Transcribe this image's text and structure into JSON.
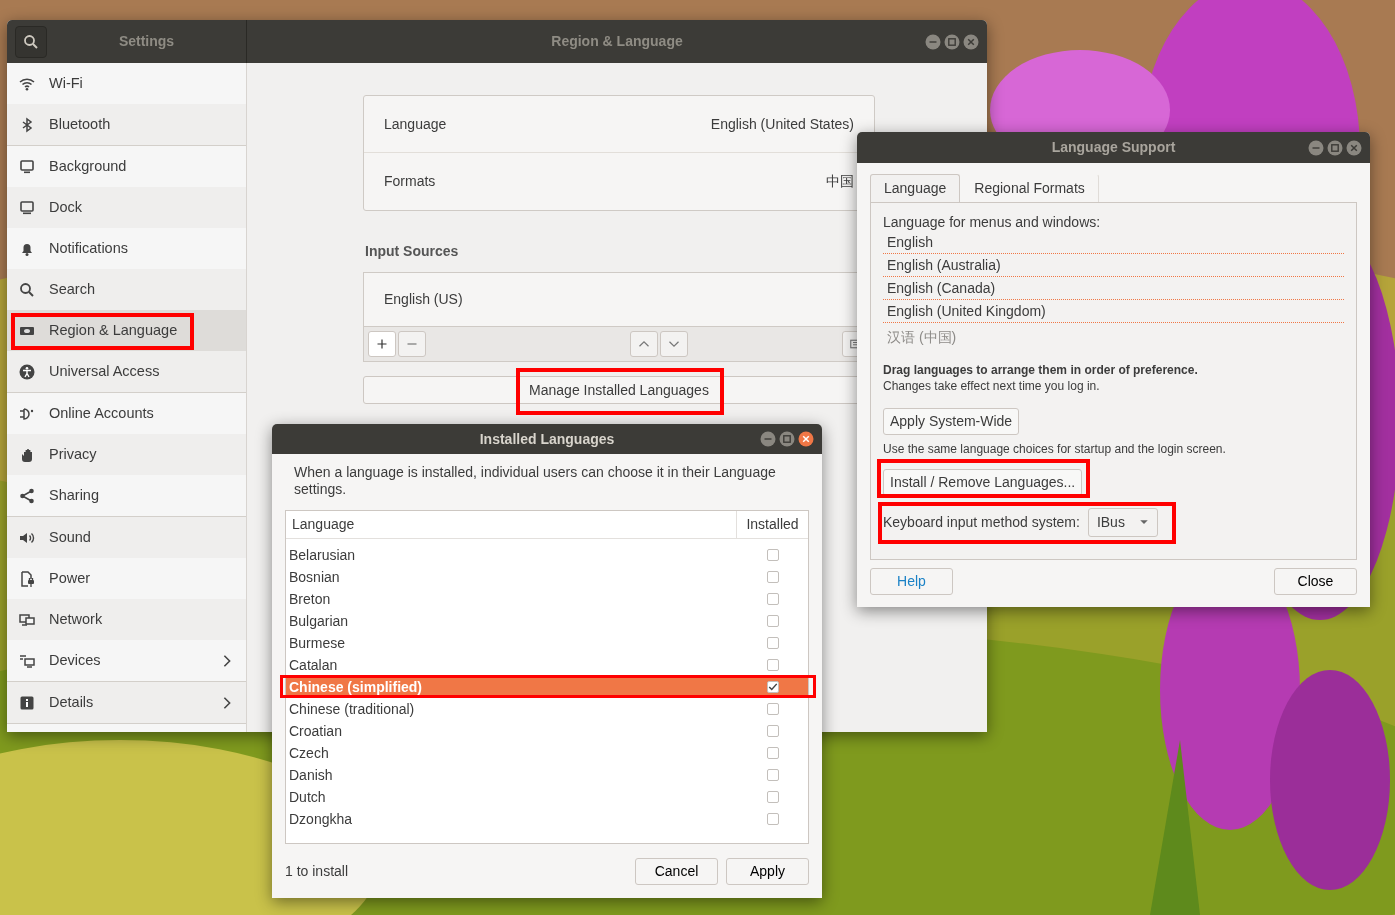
{
  "settings_window": {
    "sidebar_title": "Settings",
    "title": "Region & Language",
    "sidebar_groups": [
      [
        {
          "label": "Wi-Fi",
          "selected": false,
          "highlighted": false,
          "submenu": false
        },
        {
          "label": "Bluetooth",
          "selected": false,
          "highlighted": false,
          "submenu": false
        }
      ],
      [
        {
          "label": "Background",
          "selected": false,
          "highlighted": false,
          "submenu": false
        },
        {
          "label": "Dock",
          "selected": false,
          "highlighted": false,
          "submenu": false
        },
        {
          "label": "Notifications",
          "selected": false,
          "highlighted": false,
          "submenu": false
        },
        {
          "label": "Search",
          "selected": false,
          "highlighted": false,
          "submenu": false
        },
        {
          "label": "Region & Language",
          "selected": true,
          "highlighted": true,
          "submenu": false
        },
        {
          "label": "Universal Access",
          "selected": false,
          "highlighted": false,
          "submenu": false
        }
      ],
      [
        {
          "label": "Online Accounts",
          "selected": false,
          "highlighted": false,
          "submenu": false
        },
        {
          "label": "Privacy",
          "selected": false,
          "highlighted": false,
          "submenu": false
        },
        {
          "label": "Sharing",
          "selected": false,
          "highlighted": false,
          "submenu": false
        }
      ],
      [
        {
          "label": "Sound",
          "selected": false,
          "highlighted": false,
          "submenu": false
        },
        {
          "label": "Power",
          "selected": false,
          "highlighted": false,
          "submenu": false
        },
        {
          "label": "Network",
          "selected": false,
          "highlighted": false,
          "submenu": false
        },
        {
          "label": "Devices",
          "selected": false,
          "highlighted": false,
          "submenu": true
        }
      ],
      [
        {
          "label": "Details",
          "selected": false,
          "highlighted": false,
          "submenu": true
        }
      ]
    ],
    "language_rows": [
      {
        "label": "Language",
        "value": "English (United States)"
      },
      {
        "label": "Formats",
        "value": "中国"
      }
    ],
    "input_sources_heading": "Input Sources",
    "input_sources": [
      "English (US)"
    ],
    "manage_button": {
      "label": "Manage Installed Languages",
      "highlighted": true
    }
  },
  "language_support": {
    "title": "Language Support",
    "tabs": [
      {
        "label": "Language",
        "selected": true
      },
      {
        "label": "Regional Formats",
        "selected": false
      }
    ],
    "list_label": "Language for menus and windows:",
    "languages": [
      {
        "label": "English",
        "dimmed": false
      },
      {
        "label": "English (Australia)",
        "dimmed": false
      },
      {
        "label": "English (Canada)",
        "dimmed": false
      },
      {
        "label": "English (United Kingdom)",
        "dimmed": false
      },
      {
        "label": "汉语 (中国)",
        "dimmed": true
      }
    ],
    "drag_hint": "Drag languages to arrange them in order of preference.",
    "drag_note": "Changes take effect next time you log in.",
    "apply_button": "Apply System-Wide",
    "apply_note": "Use the same language choices for startup and the login screen.",
    "install_button": {
      "label": "Install / Remove Languages...",
      "highlighted": true
    },
    "keyboard": {
      "label": "Keyboard input method system:",
      "value": "IBus",
      "highlighted": true
    },
    "help_button": "Help",
    "close_button": "Close"
  },
  "installed_languages": {
    "title": "Installed Languages",
    "intro": "When a language is installed, individual users can choose it in their Language settings.",
    "columns": [
      "Language",
      "Installed"
    ],
    "rows": [
      {
        "name": "Belarusian",
        "installed": false,
        "selected": false,
        "highlighted": false
      },
      {
        "name": "Bosnian",
        "installed": false,
        "selected": false,
        "highlighted": false
      },
      {
        "name": "Breton",
        "installed": false,
        "selected": false,
        "highlighted": false
      },
      {
        "name": "Bulgarian",
        "installed": false,
        "selected": false,
        "highlighted": false
      },
      {
        "name": "Burmese",
        "installed": false,
        "selected": false,
        "highlighted": false
      },
      {
        "name": "Catalan",
        "installed": false,
        "selected": false,
        "highlighted": false
      },
      {
        "name": "Chinese (simplified)",
        "installed": true,
        "selected": true,
        "highlighted": true
      },
      {
        "name": "Chinese (traditional)",
        "installed": false,
        "selected": false,
        "highlighted": false
      },
      {
        "name": "Croatian",
        "installed": false,
        "selected": false,
        "highlighted": false
      },
      {
        "name": "Czech",
        "installed": false,
        "selected": false,
        "highlighted": false
      },
      {
        "name": "Danish",
        "installed": false,
        "selected": false,
        "highlighted": false
      },
      {
        "name": "Dutch",
        "installed": false,
        "selected": false,
        "highlighted": false
      },
      {
        "name": "Dzongkha",
        "installed": false,
        "selected": false,
        "highlighted": false
      }
    ],
    "status": "1 to install",
    "cancel_button": "Cancel",
    "apply_button": "Apply"
  }
}
